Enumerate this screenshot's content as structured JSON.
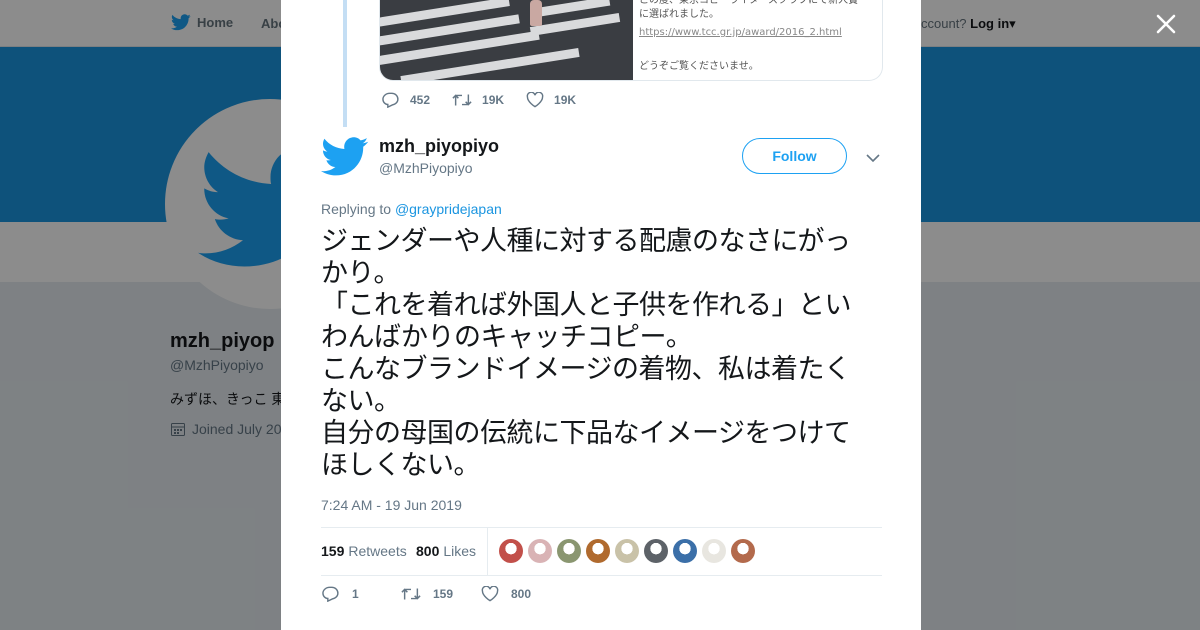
{
  "nav": {
    "home": "Home",
    "about": "Abo",
    "account_prompt": "ccount?",
    "login": "Log in"
  },
  "profile": {
    "name": "mzh_piyop",
    "handle": "@MzhPiyopiyo",
    "bio": "みずほ、きっこ 東",
    "joined": "Joined July 20"
  },
  "quoted": {
    "text_lines": [
      "この度、東京コピーライターズクラブにて新人賞",
      "に選ばれました。"
    ],
    "link": "https://www.tcc.gr.jp/award/2016_2.html",
    "closing": "どうぞご覧くださいませ。"
  },
  "quoted_actions": {
    "replies": "452",
    "retweets": "19K",
    "likes": "19K"
  },
  "tweet": {
    "author_name": "mzh_piyopiyo",
    "author_handle": "@MzhPiyopiyo",
    "follow_label": "Follow",
    "replying_prefix": "Replying to",
    "replying_to": "@graypridejapan",
    "lines": [
      "ジェンダーや人種に対する配慮のなさにがっ",
      "かり。",
      "「これを着れば外国人と子供を作れる」とい",
      "わんばかりのキャッチコピー。",
      "こんなブランドイメージの着物、私は着たく",
      "ない。",
      "自分の母国の伝統に下品なイメージをつけて",
      "ほしくない。"
    ],
    "timestamp": "7:24 AM - 19 Jun 2019",
    "retweets_count": "159",
    "retweets_label": "Retweets",
    "likes_count": "800",
    "likes_label": "Likes"
  },
  "liker_colors": [
    "#c2504a",
    "#d9b3b5",
    "#8a9670",
    "#b06a2e",
    "#c9c2a8",
    "#5d6268",
    "#3b6fa8",
    "#e8e6e0",
    "#b36a4c"
  ],
  "actions": {
    "replies": "1",
    "retweets": "159",
    "likes": "800"
  },
  "colors": {
    "brand": "#1da1f2",
    "banner": "#1b95e0",
    "thread_line": "#c4def4"
  }
}
